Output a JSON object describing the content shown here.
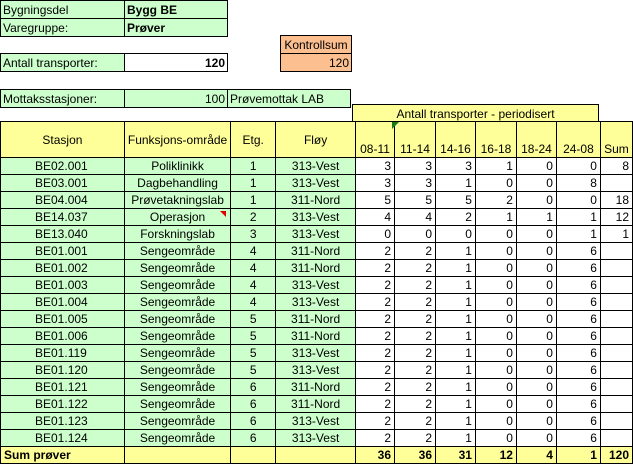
{
  "header": {
    "bygningsdel_label": "Bygningsdel",
    "bygningsdel_value": "Bygg BE",
    "varegruppe_label": "Varegruppe:",
    "varegruppe_value": "Prøver",
    "antall_label": "Antall transporter:",
    "antall_value": "120",
    "kontrollsum_label": "Kontrollsum",
    "kontrollsum_value": "120",
    "mottak_label": "Mottaksstasjoner:",
    "mottak_value": "100",
    "mottak_name": "Prøvemottak LAB"
  },
  "table": {
    "group_header": "Antall transporter - periodisert",
    "columns": [
      "Stasjon",
      "Funksjons-område",
      "Etg.",
      "Fløy",
      "08-11",
      "11-14",
      "14-16",
      "16-18",
      "18-24",
      "24-08",
      "Sum"
    ],
    "rows": [
      [
        "BE02.001",
        "Poliklinikk",
        "1",
        "313-Vest",
        "3",
        "3",
        "3",
        "1",
        "0",
        "0",
        "8"
      ],
      [
        "BE03.001",
        "Dagbehandling",
        "1",
        "313-Vest",
        "3",
        "3",
        "1",
        "0",
        "0",
        "8"
      ],
      [
        "BE04.004",
        "Prøvetakningslab",
        "1",
        "311-Nord",
        "5",
        "5",
        "5",
        "2",
        "0",
        "0",
        "18"
      ],
      [
        "BE14.037",
        "Operasjon",
        "2",
        "313-Vest",
        "4",
        "4",
        "2",
        "1",
        "1",
        "1",
        "12"
      ],
      [
        "BE13.040",
        "Forskningslab",
        "3",
        "313-Vest",
        "0",
        "0",
        "0",
        "0",
        "0",
        "1",
        "1"
      ],
      [
        "BE01.001",
        "Sengeområde",
        "4",
        "311-Nord",
        "2",
        "2",
        "1",
        "0",
        "0",
        "6"
      ],
      [
        "BE01.002",
        "Sengeområde",
        "4",
        "311-Nord",
        "2",
        "2",
        "1",
        "0",
        "0",
        "6"
      ],
      [
        "BE01.003",
        "Sengeområde",
        "4",
        "313-Vest",
        "2",
        "2",
        "1",
        "0",
        "0",
        "6"
      ],
      [
        "BE01.004",
        "Sengeområde",
        "4",
        "313-Vest",
        "2",
        "2",
        "1",
        "0",
        "0",
        "6"
      ],
      [
        "BE01.005",
        "Sengeområde",
        "5",
        "311-Nord",
        "2",
        "2",
        "1",
        "0",
        "0",
        "6"
      ],
      [
        "BE01.006",
        "Sengeområde",
        "5",
        "311-Nord",
        "2",
        "2",
        "1",
        "0",
        "0",
        "6"
      ],
      [
        "BE01.119",
        "Sengeområde",
        "5",
        "313-Vest",
        "2",
        "2",
        "1",
        "0",
        "0",
        "6"
      ],
      [
        "BE01.120",
        "Sengeområde",
        "5",
        "313-Vest",
        "2",
        "2",
        "1",
        "0",
        "0",
        "6"
      ],
      [
        "BE01.121",
        "Sengeområde",
        "6",
        "311-Nord",
        "2",
        "2",
        "1",
        "0",
        "0",
        "6"
      ],
      [
        "BE01.122",
        "Sengeområde",
        "6",
        "311-Nord",
        "2",
        "2",
        "1",
        "0",
        "0",
        "6"
      ],
      [
        "BE01.123",
        "Sengeområde",
        "6",
        "313-Vest",
        "2",
        "2",
        "1",
        "0",
        "0",
        "6"
      ],
      [
        "BE01.124",
        "Sengeområde",
        "6",
        "313-Vest",
        "2",
        "2",
        "1",
        "0",
        "0",
        "6"
      ]
    ],
    "sum_label": "Sum prøver",
    "sums": [
      "36",
      "36",
      "31",
      "12",
      "4",
      "1",
      "120"
    ]
  }
}
